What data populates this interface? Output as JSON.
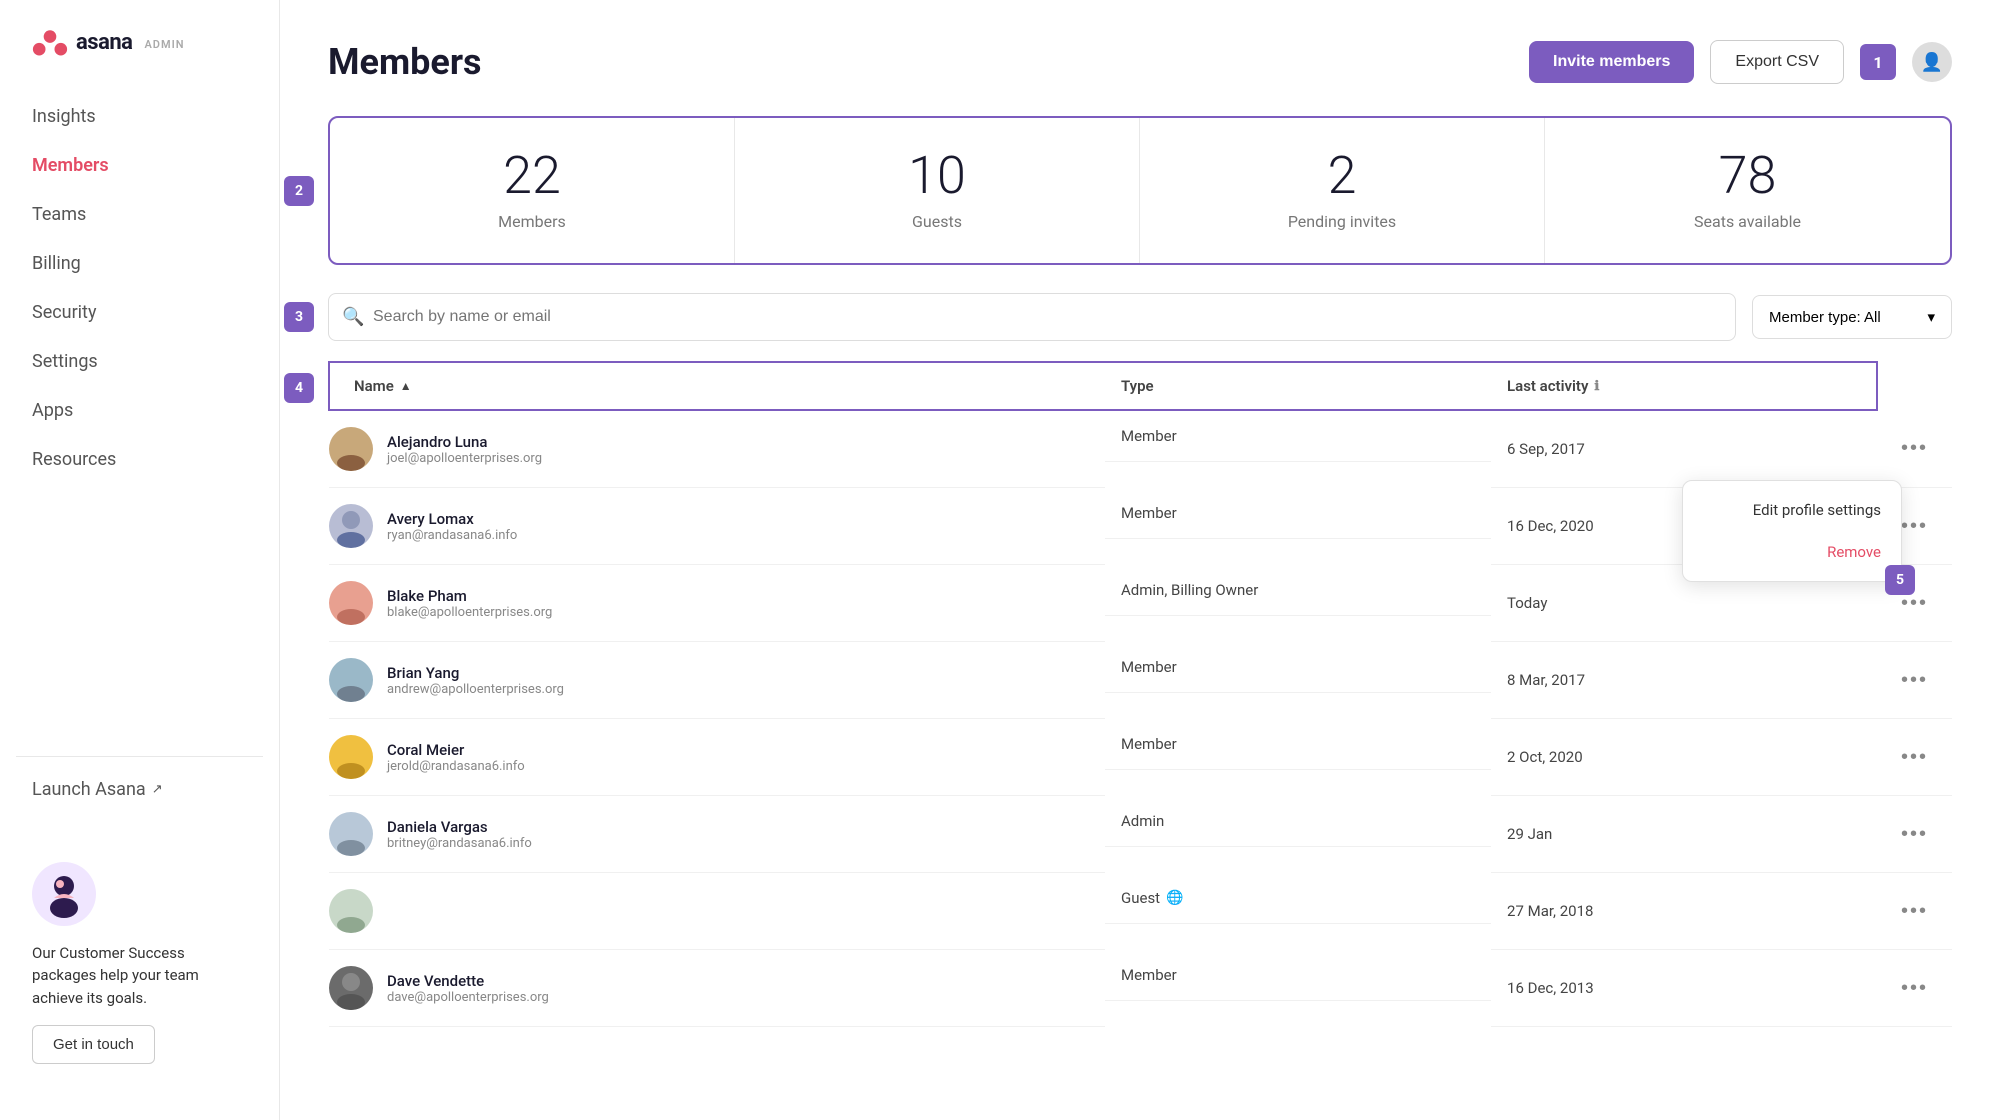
{
  "app": {
    "name": "asana",
    "admin_label": "ADMIN"
  },
  "header": {
    "title": "Members",
    "invite_button": "Invite members",
    "export_button": "Export CSV",
    "notification_count": "1"
  },
  "stats": {
    "members": {
      "value": "22",
      "label": "Members"
    },
    "guests": {
      "value": "10",
      "label": "Guests"
    },
    "pending_invites": {
      "value": "2",
      "label": "Pending invites"
    },
    "seats_available": {
      "value": "78",
      "label": "Seats available"
    }
  },
  "search": {
    "placeholder": "Search by name or email",
    "filter_label": "Member type: All"
  },
  "table": {
    "columns": {
      "name": "Name",
      "type": "Type",
      "last_activity": "Last activity"
    },
    "rows": [
      {
        "name": "Alejandro Luna",
        "email": "joel@apolloenterprises.org",
        "type": "Member",
        "last_activity": "6 Sep, 2017",
        "avatar_class": "avatar-alejandro"
      },
      {
        "name": "Avery Lomax",
        "email": "ryan@randasana6.info",
        "type": "Member",
        "last_activity": "16 Dec, 2020",
        "avatar_class": "avatar-avery",
        "has_context_menu": true
      },
      {
        "name": "Blake Pham",
        "email": "blake@apolloenterprises.org",
        "type": "Admin, Billing Owner",
        "last_activity": "Today",
        "avatar_class": "avatar-blake"
      },
      {
        "name": "Brian Yang",
        "email": "andrew@apolloenterprises.org",
        "type": "Member",
        "last_activity": "8 Mar, 2017",
        "avatar_class": "avatar-brian"
      },
      {
        "name": "Coral Meier",
        "email": "jerold@randasana6.info",
        "type": "Member",
        "last_activity": "2 Oct, 2020",
        "avatar_class": "avatar-coral"
      },
      {
        "name": "Daniela Vargas",
        "email": "britney@randasana6.info",
        "type": "Admin",
        "last_activity": "29 Jan",
        "avatar_class": "avatar-daniela"
      },
      {
        "name": "",
        "email": "",
        "type": "Guest",
        "last_activity": "27 Mar, 2018",
        "avatar_class": "avatar-guest",
        "has_globe": true
      },
      {
        "name": "Dave Vendette",
        "email": "dave@apolloenterprises.org",
        "type": "Member",
        "last_activity": "16 Dec, 2013",
        "avatar_class": "avatar-dave"
      }
    ]
  },
  "context_menu": {
    "edit_label": "Edit profile settings",
    "remove_label": "Remove"
  },
  "sidebar": {
    "nav_items": [
      {
        "id": "insights",
        "label": "Insights",
        "active": false
      },
      {
        "id": "members",
        "label": "Members",
        "active": true
      },
      {
        "id": "teams",
        "label": "Teams",
        "active": false
      },
      {
        "id": "billing",
        "label": "Billing",
        "active": false
      },
      {
        "id": "security",
        "label": "Security",
        "active": false
      },
      {
        "id": "settings",
        "label": "Settings",
        "active": false
      },
      {
        "id": "apps",
        "label": "Apps",
        "active": false
      },
      {
        "id": "resources",
        "label": "Resources",
        "active": false
      }
    ],
    "launch_asana": "Launch Asana",
    "promo": {
      "text": "Our Customer Success packages help your team achieve its goals.",
      "button": "Get in touch"
    }
  },
  "step_badges": {
    "s2": "2",
    "s3": "3",
    "s4": "4",
    "s5": "5"
  }
}
